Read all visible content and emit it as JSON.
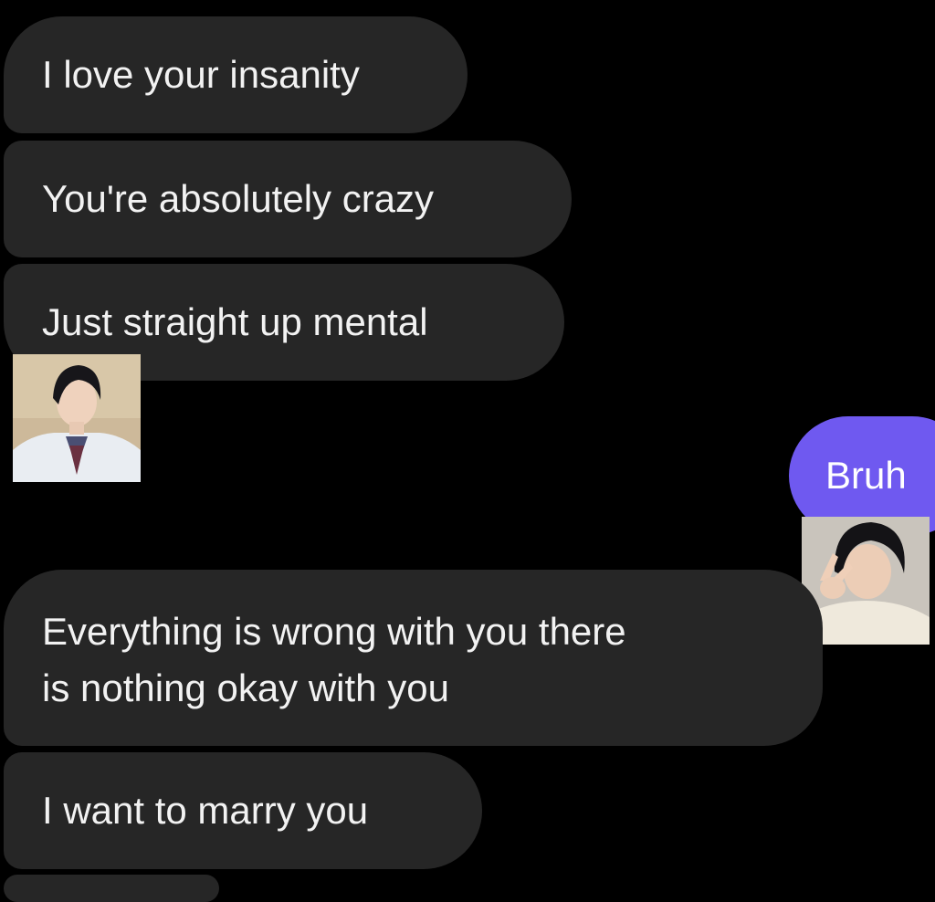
{
  "messages": [
    {
      "text": "I love your insanity",
      "direction": "received"
    },
    {
      "text": "You're absolutely crazy",
      "direction": "received"
    },
    {
      "text": "Just straight up mental",
      "direction": "received"
    },
    {
      "text": "Bruh",
      "direction": "sent"
    },
    {
      "text": "Everything is wrong with you there is nothing okay with you",
      "direction": "received",
      "lines": [
        "Everything is wrong with you there",
        "is nothing okay with you"
      ]
    },
    {
      "text": "I want to marry you",
      "direction": "received"
    }
  ],
  "colors": {
    "background": "#000000",
    "received_bubble": "#262626",
    "sent_bubble": "#6f59f0",
    "text": "#f2f2f2"
  }
}
